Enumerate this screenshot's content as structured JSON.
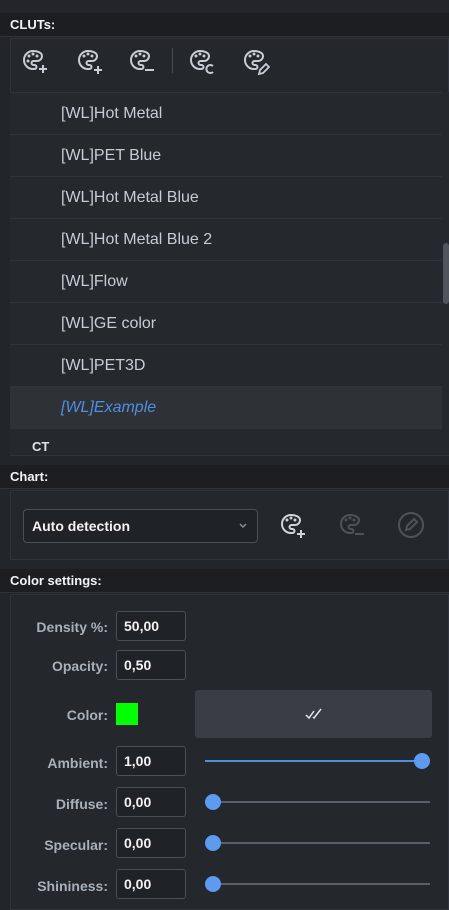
{
  "sections": {
    "cluts": "CLUTs:",
    "chart": "Chart:",
    "color_settings": "Color settings:"
  },
  "toolbar": {
    "icons": [
      "palette-add-icon",
      "palette-add-alt-icon",
      "palette-remove-icon",
      "palette-copy-icon",
      "palette-edit-icon"
    ]
  },
  "clut_list": {
    "items": [
      {
        "label": "[WL]Hot Metal",
        "selected": false
      },
      {
        "label": "[WL]PET Blue",
        "selected": false
      },
      {
        "label": "[WL]Hot Metal Blue",
        "selected": false
      },
      {
        "label": "[WL]Hot Metal Blue 2",
        "selected": false
      },
      {
        "label": "[WL]Flow",
        "selected": false
      },
      {
        "label": "[WL]GE color",
        "selected": false
      },
      {
        "label": "[WL]PET3D",
        "selected": false
      },
      {
        "label": "[WL]Example",
        "selected": true
      }
    ],
    "category": "CT"
  },
  "chart": {
    "selected_option": "Auto detection",
    "icons": [
      "palette-add-icon",
      "palette-remove-icon",
      "edit-icon"
    ]
  },
  "settings": {
    "density": {
      "label": "Density %:",
      "value": "50,00"
    },
    "opacity": {
      "label": "Opacity:",
      "value": "0,50"
    },
    "color": {
      "label": "Color:",
      "value": "#00ff00"
    },
    "ambient": {
      "label": "Ambient:",
      "value": "1,00",
      "level": 1.0
    },
    "diffuse": {
      "label": "Diffuse:",
      "value": "0,00",
      "level": 0.0
    },
    "specular": {
      "label": "Specular:",
      "value": "0,00",
      "level": 0.0
    },
    "shininess": {
      "label": "Shininess:",
      "value": "0,00",
      "level": 0.0
    }
  },
  "colors": {
    "accent": "#4d8fe0",
    "slider_thumb": "#5d9bf0",
    "swatch": "#00ff00",
    "background": "#222529"
  }
}
